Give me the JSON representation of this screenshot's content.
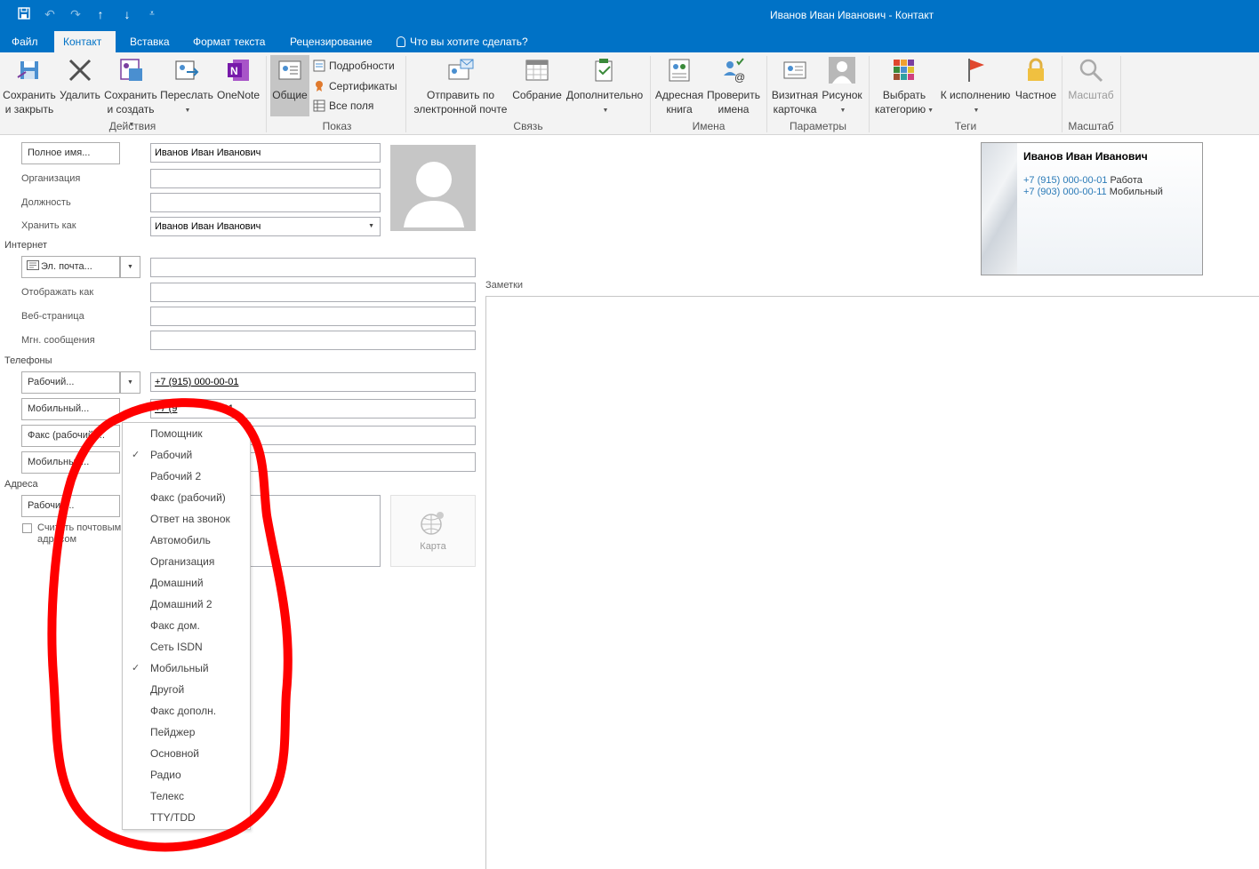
{
  "window": {
    "title": "Иванов Иван Иванович - Контакт"
  },
  "quick_access": [
    "save-icon",
    "undo-icon",
    "redo-icon",
    "up-arrow-icon",
    "down-arrow-icon",
    "customize-icon"
  ],
  "tabs": [
    {
      "label": "Файл"
    },
    {
      "label": "Контакт",
      "active": true
    },
    {
      "label": "Вставка"
    },
    {
      "label": "Формат текста"
    },
    {
      "label": "Рецензирование"
    },
    {
      "label": "Что вы хотите сделать?"
    }
  ],
  "ribbon": {
    "groups": {
      "actions": "Действия",
      "show": "Показ",
      "communicate": "Связь",
      "names": "Имена",
      "options": "Параметры",
      "tags": "Теги",
      "zoom": "Масштаб"
    },
    "save_close": [
      "Сохранить",
      "и закрыть"
    ],
    "delete": "Удалить",
    "save_new": [
      "Сохранить",
      "и создать"
    ],
    "forward": "Переслать",
    "onenote": "OneNote",
    "general": "Общие",
    "details": "Подробности",
    "certificates": "Сертификаты",
    "all_fields": "Все поля",
    "send_email": [
      "Отправить по",
      "электронной почте"
    ],
    "meeting": "Собрание",
    "more": "Дополнительно",
    "address_book": [
      "Адресная",
      "книга"
    ],
    "check_names": [
      "Проверить",
      "имена"
    ],
    "business_card": [
      "Визитная",
      "карточка"
    ],
    "picture": "Рисунок",
    "categorize": [
      "Выбрать",
      "категорию"
    ],
    "follow_up": "К исполнению",
    "private": "Частное",
    "zoom": "Масштаб"
  },
  "form": {
    "full_name_btn": "Полное имя...",
    "full_name": "Иванов Иван Иванович",
    "company_label": "Организация",
    "company": "",
    "job_title_label": "Должность",
    "job_title": "",
    "file_as_label": "Хранить как",
    "file_as": "Иванов Иван Иванович",
    "internet_section": "Интернет",
    "email_btn": "Эл. почта...",
    "email": "",
    "display_as_label": "Отображать как",
    "display_as": "",
    "web_page_label": "Веб-страница",
    "web_page": "",
    "im_label": "Мгн. сообщения",
    "im": "",
    "phones_section": "Телефоны",
    "phone1_btn": "Рабочий...",
    "phone1": "+7 (915) 000-00-01",
    "phone2_btn": "Мобильный...",
    "phone2_visible": "+7 (9",
    "phone2_tail": "11",
    "phone3_btn": "Факс (рабочий)...",
    "phone4_btn": "Мобильный...",
    "addresses_section": "Адреса",
    "address_btn": "Рабочий...",
    "mailing_checkbox": [
      "Считать почтовым",
      "адресом"
    ],
    "map_label": "Карта",
    "notes_label": "Заметки"
  },
  "business_card": {
    "name": "Иванов Иван Иванович",
    "lines": [
      {
        "number": "+7 (915) 000-00-01",
        "type": "Работа"
      },
      {
        "number": "+7 (903) 000-00-11",
        "type": "Мобильный"
      }
    ]
  },
  "phone_type_menu": [
    {
      "label": "Помощник",
      "checked": false
    },
    {
      "label": "Рабочий",
      "checked": true
    },
    {
      "label": "Рабочий 2",
      "checked": false
    },
    {
      "label": "Факс (рабочий)",
      "checked": false
    },
    {
      "label": "Ответ на звонок",
      "checked": false
    },
    {
      "label": "Автомобиль",
      "checked": false
    },
    {
      "label": "Организация",
      "checked": false
    },
    {
      "label": "Домашний",
      "checked": false
    },
    {
      "label": "Домашний 2",
      "checked": false
    },
    {
      "label": "Факс дом.",
      "checked": false
    },
    {
      "label": "Сеть ISDN",
      "checked": false
    },
    {
      "label": "Мобильный",
      "checked": true
    },
    {
      "label": "Другой",
      "checked": false
    },
    {
      "label": "Факс дополн.",
      "checked": false
    },
    {
      "label": "Пейджер",
      "checked": false
    },
    {
      "label": "Основной",
      "checked": false
    },
    {
      "label": "Радио",
      "checked": false
    },
    {
      "label": "Телекс",
      "checked": false
    },
    {
      "label": "TTY/TDD",
      "checked": false
    }
  ],
  "colors": {
    "accent": "#0072c6",
    "annotation": "#ff0000",
    "link": "#2a7ab7"
  }
}
